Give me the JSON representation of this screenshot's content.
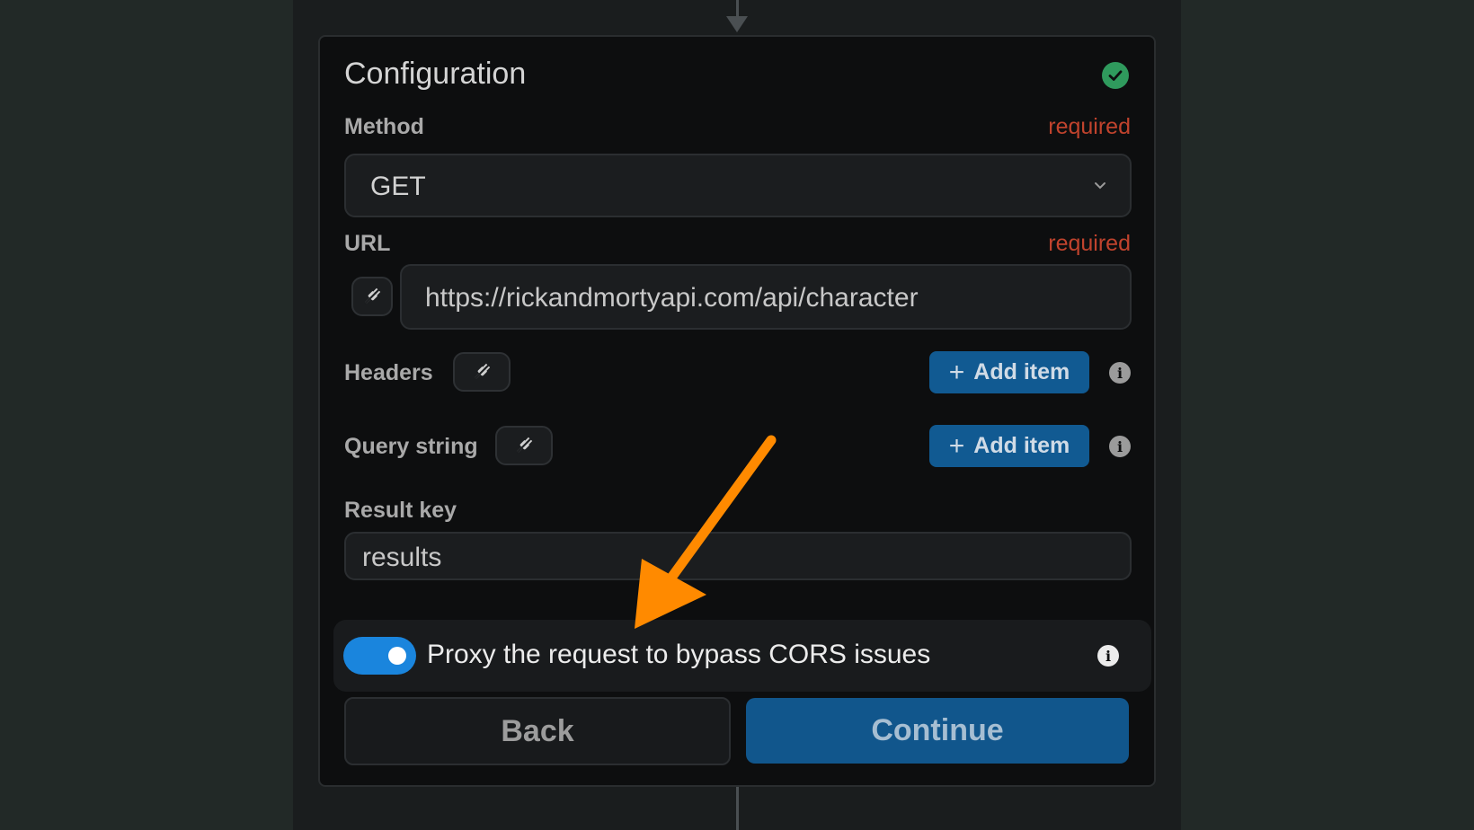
{
  "card": {
    "title": "Configuration",
    "status_icon": "check-circle-icon",
    "accent_color": "#2f9a5d"
  },
  "method": {
    "label": "Method",
    "required_label": "required",
    "value": "GET"
  },
  "url": {
    "label": "URL",
    "required_label": "required",
    "value": "https://rickandmortyapi.com/api/character"
  },
  "headers": {
    "label": "Headers",
    "add_label": "Add item"
  },
  "query_string": {
    "label": "Query string",
    "add_label": "Add item"
  },
  "result_key": {
    "label": "Result key",
    "value": "results"
  },
  "proxy": {
    "label": "Proxy the request to bypass CORS issues",
    "enabled": true
  },
  "actions": {
    "back_label": "Back",
    "continue_label": "Continue"
  },
  "colors": {
    "primary_button": "#115a92",
    "toggle_on": "#1a85dd",
    "required": "#c0432d",
    "annotation_arrow": "#ff8a00"
  }
}
